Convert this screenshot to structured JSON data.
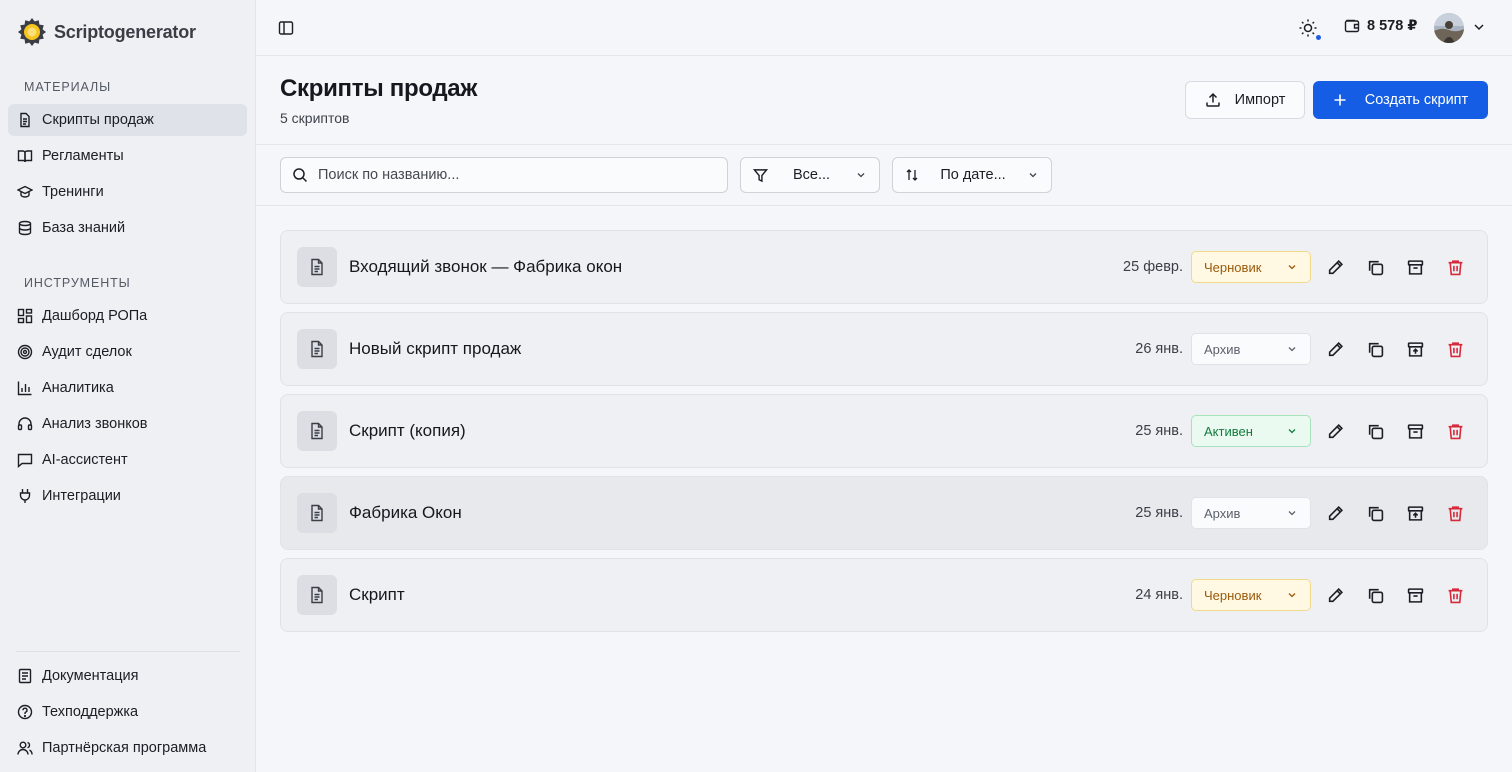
{
  "app": {
    "name": "Scriptogenerator"
  },
  "sidebar": {
    "sections": [
      {
        "title": "МАТЕРИАЛЫ",
        "items": [
          {
            "label": "Скрипты продаж",
            "icon": "document-icon"
          },
          {
            "label": "Регламенты",
            "icon": "book-icon"
          },
          {
            "label": "Тренинги",
            "icon": "graduation-cap-icon"
          },
          {
            "label": "База знаний",
            "icon": "database-icon"
          }
        ]
      },
      {
        "title": "ИНСТРУМЕНТЫ",
        "items": [
          {
            "label": "Дашборд РОПа",
            "icon": "dashboard-icon"
          },
          {
            "label": "Аудит сделок",
            "icon": "target-icon"
          },
          {
            "label": "Аналитика",
            "icon": "bar-chart-icon"
          },
          {
            "label": "Анализ звонков",
            "icon": "headset-icon"
          },
          {
            "label": "AI-ассистент",
            "icon": "message-icon"
          },
          {
            "label": "Интеграции",
            "icon": "plug-icon"
          }
        ]
      }
    ],
    "footer": [
      {
        "label": "Документация",
        "icon": "doc-icon"
      },
      {
        "label": "Техподдержка",
        "icon": "help-circle-icon"
      },
      {
        "label": "Партнёрская программа",
        "icon": "users-icon"
      }
    ]
  },
  "topbar": {
    "balance": "8 578 ₽"
  },
  "page": {
    "title": "Скрипты продаж",
    "subtitle": "5 скриптов",
    "import_label": "Импорт",
    "create_label": "Создать скрипт"
  },
  "filters": {
    "search_placeholder": "Поиск по названию...",
    "status_filter": "Все...",
    "sort": "По дате..."
  },
  "scripts": [
    {
      "title": "Входящий звонок — Фабрика окон",
      "date": "25 февр.",
      "status": "Черновик",
      "status_kind": "draft"
    },
    {
      "title": "Новый скрипт продаж",
      "date": "26 янв.",
      "status": "Архив",
      "status_kind": "archive"
    },
    {
      "title": "Скрипт (копия)",
      "date": "25 янв.",
      "status": "Активен",
      "status_kind": "active"
    },
    {
      "title": "Фабрика Окон",
      "date": "25 янв.",
      "status": "Архив",
      "status_kind": "archive"
    },
    {
      "title": "Скрипт",
      "date": "24 янв.",
      "status": "Черновик",
      "status_kind": "draft"
    }
  ],
  "colors": {
    "accent": "#145de4",
    "delete": "#d6293a"
  }
}
